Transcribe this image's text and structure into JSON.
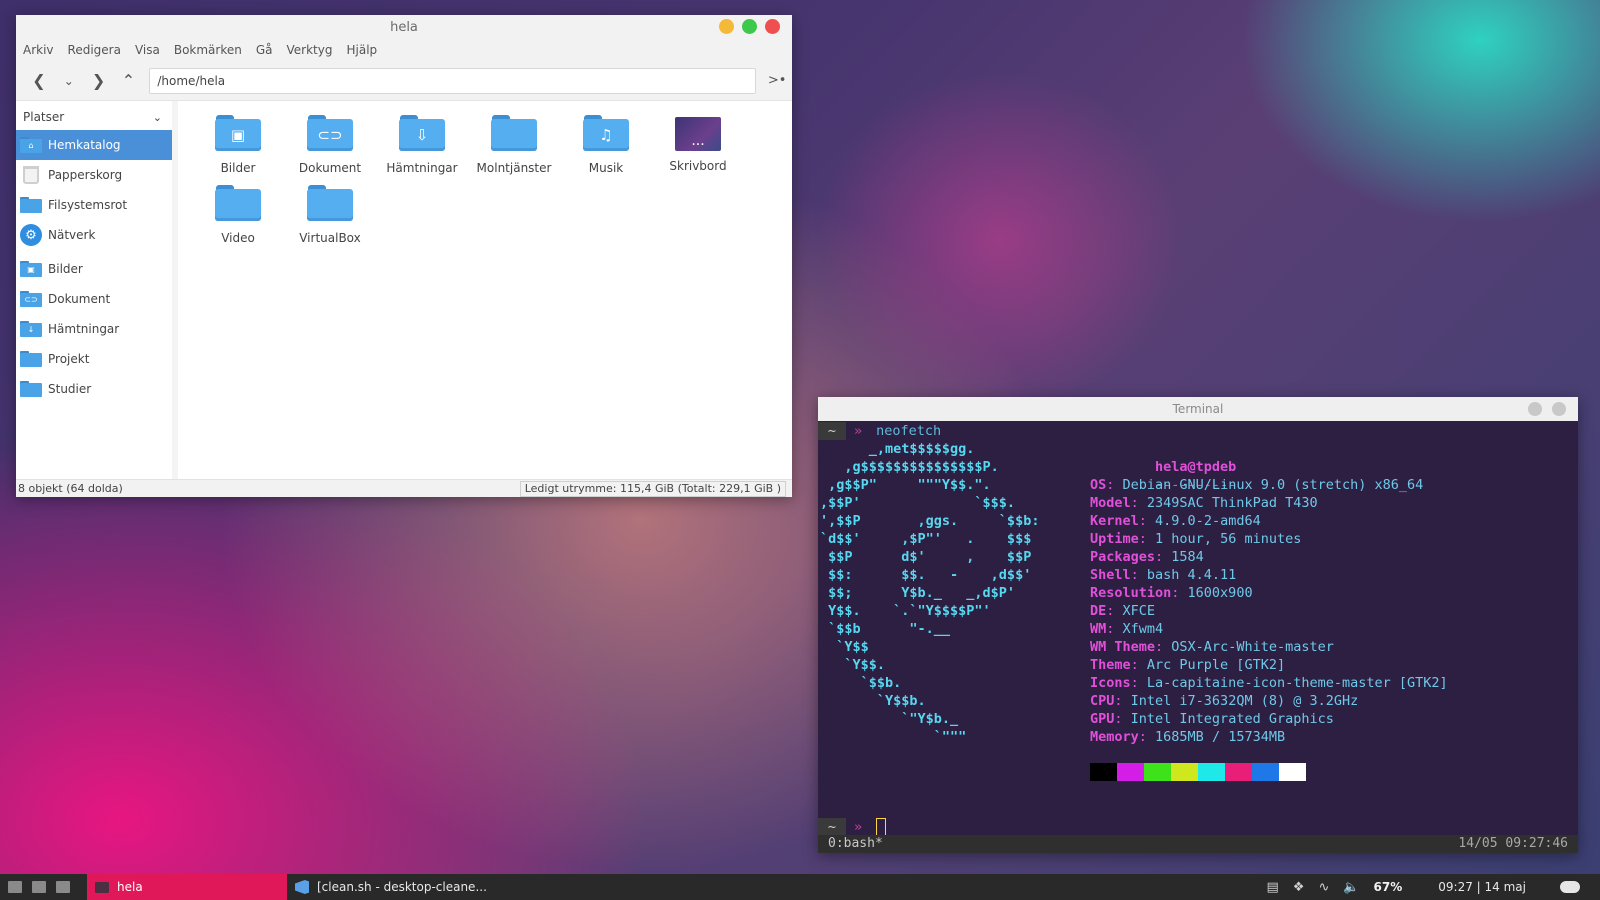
{
  "file_manager": {
    "title": "hela",
    "menu": [
      "Arkiv",
      "Redigera",
      "Visa",
      "Bokmärken",
      "Gå",
      "Verktyg",
      "Hjälp"
    ],
    "path": "/home/hela",
    "sidebar": {
      "header": "Platser",
      "items": [
        {
          "label": "Hemkatalog",
          "icon": "home-folder-icon",
          "glyph": "⌂",
          "active": true
        },
        {
          "label": "Papperskorg",
          "icon": "trash-icon"
        },
        {
          "label": "Filsystemsrot",
          "icon": "drive-folder-icon",
          "glyph": ""
        },
        {
          "label": "Nätverk",
          "icon": "network-icon",
          "glyph": "⚙"
        },
        {
          "label": "Bilder",
          "icon": "pictures-folder-icon",
          "glyph": "▣"
        },
        {
          "label": "Dokument",
          "icon": "documents-folder-icon",
          "glyph": "⊂⊃"
        },
        {
          "label": "Hämtningar",
          "icon": "downloads-folder-icon",
          "glyph": "↓"
        },
        {
          "label": "Projekt",
          "icon": "folder-icon",
          "glyph": ""
        },
        {
          "label": "Studier",
          "icon": "folder-icon",
          "glyph": ""
        }
      ]
    },
    "files": [
      {
        "label": "Bilder",
        "icon": "pictures-folder-icon",
        "glyph": "▣"
      },
      {
        "label": "Dokument",
        "icon": "documents-folder-icon",
        "glyph": "⊂⊃"
      },
      {
        "label": "Hämtningar",
        "icon": "downloads-folder-icon",
        "glyph": "⇩"
      },
      {
        "label": "Molntjänster",
        "icon": "cloud-folder-icon",
        "glyph": ""
      },
      {
        "label": "Musik",
        "icon": "music-folder-icon",
        "glyph": "♫"
      },
      {
        "label": "Skrivbord",
        "icon": "desktop-folder-icon",
        "glyph": "..."
      },
      {
        "label": "Video",
        "icon": "video-folder-icon",
        "glyph": ""
      },
      {
        "label": "VirtualBox",
        "icon": "folder-icon",
        "glyph": ""
      }
    ],
    "status_left": "8 objekt (64 dolda)",
    "status_right": "Ledigt utrymme: 115,4 GiB (Totalt: 229,1 GiB )"
  },
  "terminal": {
    "title": "Terminal",
    "prompt_tilde": "~",
    "prompt_arrow": "»",
    "command": "neofetch",
    "logo": "      _,met$$$$$gg.\n   ,g$$$$$$$$$$$$$$$P.\n ,g$$P\"     \"\"\"Y$$.\".\n,$$P'              `$$$.\n',$$P       ,ggs.     `$$b:\n`d$$'     ,$P\"'   .    $$$\n $$P      d$'     ,    $$P\n $$:      $$.   -    ,d$$'\n $$;      Y$b._   _,d$P'\n Y$$.    `.`\"Y$$$$P\"'\n `$$b      \"-.__\n  `Y$$\n   `Y$$.\n     `$$b.\n       `Y$$b.\n          `\"Y$b._\n              `\"\"\"",
    "user_host": "hela@tpdeb",
    "underline": "----------",
    "info": [
      {
        "key": "OS",
        "value": "Debian GNU/Linux 9.0 (stretch) x86_64"
      },
      {
        "key": "Model",
        "value": "2349SAC ThinkPad T430"
      },
      {
        "key": "Kernel",
        "value": "4.9.0-2-amd64"
      },
      {
        "key": "Uptime",
        "value": "1 hour, 56 minutes"
      },
      {
        "key": "Packages",
        "value": "1584"
      },
      {
        "key": "Shell",
        "value": "bash 4.4.11"
      },
      {
        "key": "Resolution",
        "value": "1600x900"
      },
      {
        "key": "DE",
        "value": "XFCE"
      },
      {
        "key": "WM",
        "value": "Xfwm4"
      },
      {
        "key": "WM Theme",
        "value": "OSX-Arc-White-master"
      },
      {
        "key": "Theme",
        "value": "Arc Purple [GTK2]"
      },
      {
        "key": "Icons",
        "value": "La-capitaine-icon-theme-master [GTK2]"
      },
      {
        "key": "CPU",
        "value": "Intel i7-3632QM (8) @ 3.2GHz"
      },
      {
        "key": "GPU",
        "value": "Intel Integrated Graphics"
      },
      {
        "key": "Memory",
        "value": "1685MB / 15734MB"
      }
    ],
    "palette": [
      "#000000",
      "#d41ee8",
      "#3ee21a",
      "#cfe81e",
      "#1ee8e8",
      "#e81e78",
      "#1e78e8",
      "#ffffff"
    ],
    "tmux_left": "0:bash*",
    "tmux_right": "14/05  09:27:46"
  },
  "panel": {
    "active_task": "hela",
    "task2": "[clean.sh - desktop-cleane...",
    "battery": "67%",
    "clock": "09:27 | 14 maj"
  },
  "colors": {
    "accent": "#4a90d9",
    "task_active": "#e0185a",
    "wm_close": "#ee4f4f",
    "wm_max": "#3dc94b",
    "wm_min": "#f5b93a"
  }
}
